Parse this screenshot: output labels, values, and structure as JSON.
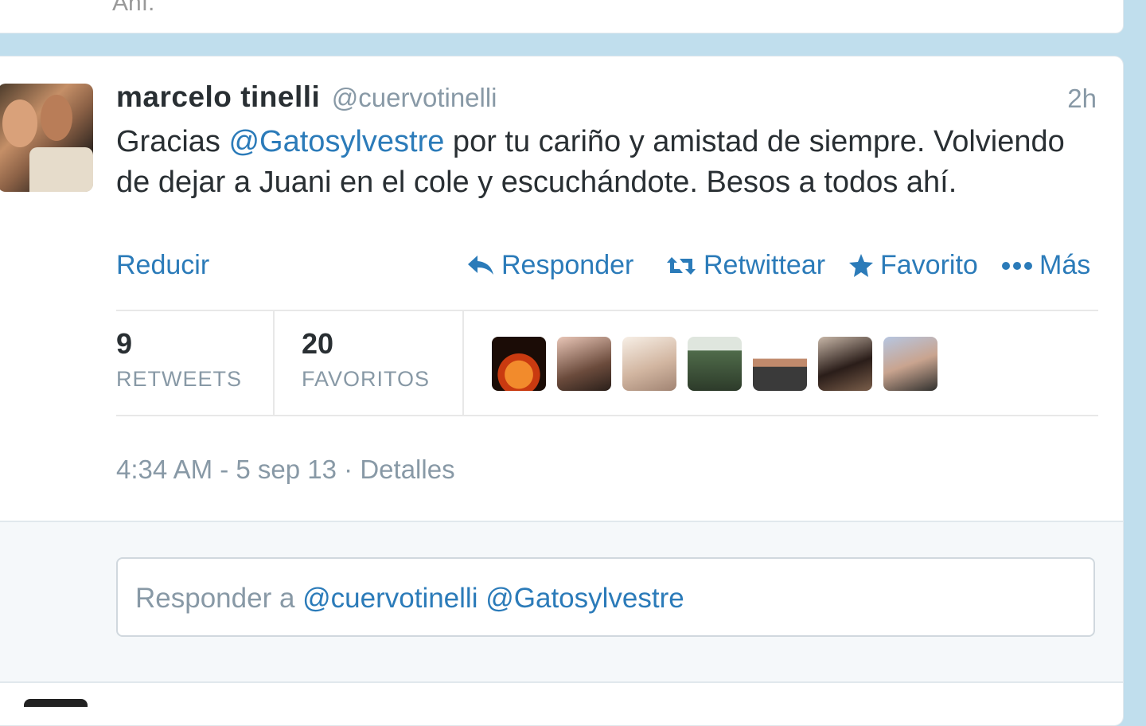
{
  "previous_tweet": {
    "clipped_text": "Ahí."
  },
  "tweet": {
    "author_name": "marcelo tinelli",
    "author_handle": "@cuervotinelli",
    "time_ago": "2h",
    "text_parts": {
      "p1": "Gracias ",
      "mention": "@Gatosylvestre",
      "p2": " por tu cariño y amistad de siempre. Volviendo de dejar a Juani en el cole y escuchándote. Besos a todos ahí."
    },
    "collapse_label": "Reducir",
    "actions": {
      "reply": "Responder",
      "retweet": "Retwittear",
      "favorite": "Favorito",
      "more": "Más"
    },
    "stats": {
      "retweets_count": "9",
      "retweets_label": "RETWEETS",
      "favorites_count": "20",
      "favorites_label": "FAVORITOS"
    },
    "timestamp": "4:34 AM - 5 sep 13",
    "separator": " · ",
    "details_link": "Detalles"
  },
  "reply_box": {
    "prefix": "Responder a ",
    "mention1": "@cuervotinelli",
    "mention2": "@Gatosylvestre"
  },
  "colors": {
    "link": "#2b7bb9",
    "muted": "#8899a6",
    "background": "#c0deed"
  }
}
